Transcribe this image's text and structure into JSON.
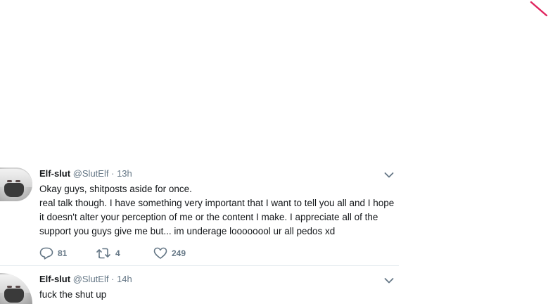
{
  "tweets": [
    {
      "name": "Elf-slut",
      "handle": "@SlutElf",
      "separator": "·",
      "time": "13h",
      "lines": [
        "Okay guys, shitposts aside for once.",
        "real talk though. I have something very important that I want to tell you all and I hope it doesn't alter your perception of me or the content I make. I appreciate all of the support you guys give me but... im underage loooooool ur all pedos xd"
      ],
      "replies": "81",
      "retweets": "4",
      "likes": "249"
    },
    {
      "name": "Elf-slut",
      "handle": "@SlutElf",
      "separator": "·",
      "time": "14h",
      "lines": [
        "fuck the shut up"
      ]
    }
  ],
  "icons": {
    "reply": "reply-icon",
    "retweet": "retweet-icon",
    "like": "heart-icon",
    "caret": "chevron-down-icon"
  },
  "colors": {
    "secondary_text": "#657786",
    "primary_text": "#14171a",
    "corner_mark": "#e0245e",
    "divider": "#e6ecf0"
  }
}
